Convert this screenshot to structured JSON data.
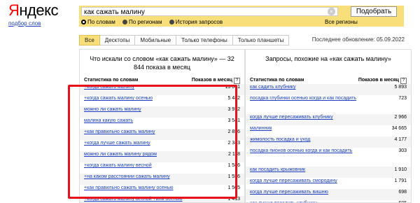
{
  "logo": {
    "first_letter": "Я",
    "rest": "ндекс",
    "sub_link": "подбор слов"
  },
  "search": {
    "query": "как сажать малину",
    "button_label": "Подобрать",
    "modes": [
      {
        "label": "По словам",
        "selected": true
      },
      {
        "label": "По регионам",
        "selected": false
      },
      {
        "label": "История запросов",
        "selected": false
      }
    ],
    "regions_label": "Все регионы"
  },
  "tabs": [
    {
      "label": "Все",
      "active": true
    },
    {
      "label": "Десктопы",
      "active": false
    },
    {
      "label": "Мобильные",
      "active": false
    },
    {
      "label": "Только телефоны",
      "active": false
    },
    {
      "label": "Только планшеты",
      "active": false
    }
  ],
  "updated": "Последнее обновление: 05.09.2022",
  "left_panel": {
    "title": "Что искали со словом «как сажать малину» — 32 844 показа в месяц",
    "col_words": "Статистика по словам",
    "col_count": "Показов в месяц",
    "rows": [
      {
        "kw": "+когда сажать малину",
        "num": "13 001"
      },
      {
        "kw": "+когда сажать малину осенью",
        "num": "5 482"
      },
      {
        "kw": "можно ли сажать малину",
        "num": "3 972"
      },
      {
        "kw": "малина какую сажать",
        "num": "3 541"
      },
      {
        "kw": "+как правильно сажать малину",
        "num": "2 856"
      },
      {
        "kw": "+когда лучше сажать малину",
        "num": "2 343"
      },
      {
        "kw": "можно ли сажать малину рядом",
        "num": "2 118"
      },
      {
        "kw": "+когда сажать малину весной",
        "num": "1 586"
      },
      {
        "kw": "+на каком расстоянии сажать малину",
        "num": "1 556"
      },
      {
        "kw": "+как правильно сажать малину осенью",
        "num": "1 505"
      },
      {
        "kw": "+когда сажать малину весной +или осенью",
        "num": "1 413"
      }
    ]
  },
  "right_panel": {
    "title": "Запросы, похожие на «как сажать малину»",
    "col_words": "Статистика по словам",
    "col_count": "Показов в месяц",
    "rows": [
      {
        "kw": "как садить клубнику",
        "num": "5 893"
      },
      {
        "kw": "посадка глубинки осенью когда и как посадить",
        "num": "723"
      },
      {
        "kw": "когда лучше пересаживать клубнику",
        "num": "2 966"
      },
      {
        "kw": "малинник",
        "num": "34 665"
      },
      {
        "kw": "жимолость посадка и уход",
        "num": "4 177"
      },
      {
        "kw": "посадка пионов осенью когда и как посадить",
        "num": "303"
      },
      {
        "kw": "как посадить крыжовник",
        "num": "1 910"
      },
      {
        "kw": "когда лучше пересаживать смородину",
        "num": "1 791"
      },
      {
        "kw": "когда лучше пересаживать вишню",
        "num": "698"
      },
      {
        "kw": "как лучше посадить клубнику",
        "num": "686"
      }
    ]
  },
  "colors": {
    "accent": "#f9df7a",
    "highlight": "#e8101b",
    "link": "#1a3dc1"
  }
}
